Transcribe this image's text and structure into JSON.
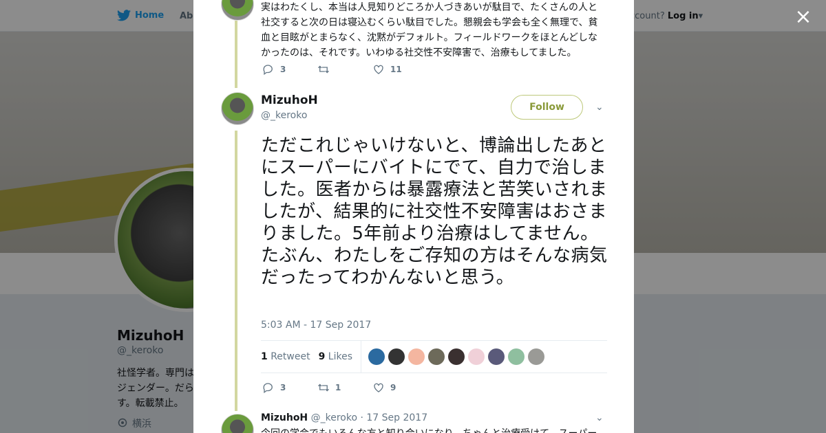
{
  "topnav": {
    "home_label": "Home",
    "about_label": "Abo",
    "login_prefix": "ccount?",
    "login_label": "Log in"
  },
  "profile": {
    "name": "MizuhoH",
    "handle": "@_keroko",
    "bio": "社怪学者。専門は ジェンダー。だら す。転載禁止。",
    "location": "横浜"
  },
  "modal": {
    "close_label": "×",
    "prev_tweet": {
      "text": "実はわたくし、本当は人見知りどころか人づきあいが駄目で、たくさんの人と社交すると次の日は寝込むくらい駄目でした。懇親会も学会も全く無理で、貧血と目眩がとまらなく、沈黙がデフォルト。フィールドワークをほとんどしなかったのは、それです。いわゆる社交性不安障害で、治療もしてました。",
      "reply_count": "3",
      "retweet_count": "",
      "like_count": "11"
    },
    "main_tweet": {
      "name": "MizuhoH",
      "handle": "@_keroko",
      "follow_label": "Follow",
      "text": "ただこれじゃいけないと、博論出したあとにスーパーにバイトにでて、自力で治しました。医者からは暴露療法と苦笑いされましたが、結果的に社交性不安障害はおさまりました。5年前より治療はしてません。たぶん、わたしをご存知の方はそんな病気だったってわかんないと思う。",
      "timestamp": "5:03 AM - 17 Sep 2017",
      "retweets_num": "1",
      "retweets_label": "Retweet",
      "likes_num": "9",
      "likes_label": "Likes",
      "reply_count": "3",
      "retweet_count": "1",
      "like_count": "9",
      "liker_colors": [
        "#2b6aa0",
        "#333333",
        "#f4b6a0",
        "#6d6a5a",
        "#3a3030",
        "#f0d0d8",
        "#5a5a7a",
        "#8fbf9f",
        "#9a9a96"
      ]
    },
    "next_tweet": {
      "name": "MizuhoH",
      "handle": "@_keroko",
      "date": "· 17 Sep 2017",
      "text": "今回の学会でもいろんな方と知り合いになり、ちゃんと治療受けて、スーパー"
    }
  }
}
